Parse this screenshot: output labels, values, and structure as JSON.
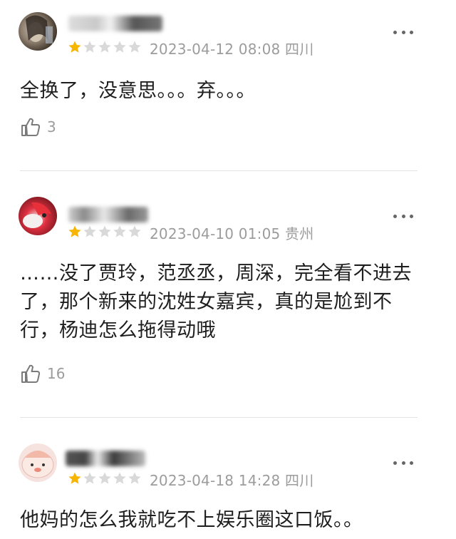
{
  "comments": [
    {
      "date": "2023-04-12 08:08",
      "region": "四川",
      "rating": 1,
      "text": "全换了，没意思。。。弃。。。",
      "likes": "3",
      "avatar": "avatar-photo-dark"
    },
    {
      "date": "2023-04-10 01:05",
      "region": "贵州",
      "rating": 1,
      "text": "……没了贾玲，范丞丞，周深，完全看不进去了，那个新来的沈姓女嘉宾，真的是尬到不行，杨迪怎么拖得动哦",
      "likes": "16",
      "avatar": "avatar-red-character"
    },
    {
      "date": "2023-04-18 14:28",
      "region": "四川",
      "rating": 1,
      "text": "他妈的怎么我就吃不上娱乐圈这口饭。。",
      "likes": "",
      "avatar": "avatar-cartoon-face"
    }
  ],
  "icons": {
    "more": "more-dots-icon",
    "like": "thumbs-up-icon",
    "star": "star-icon"
  },
  "colors": {
    "star_filled": "#f7b500",
    "star_empty": "#d9d9d9",
    "meta_text": "#9c9c9c",
    "body_text": "#1e1e1e"
  }
}
